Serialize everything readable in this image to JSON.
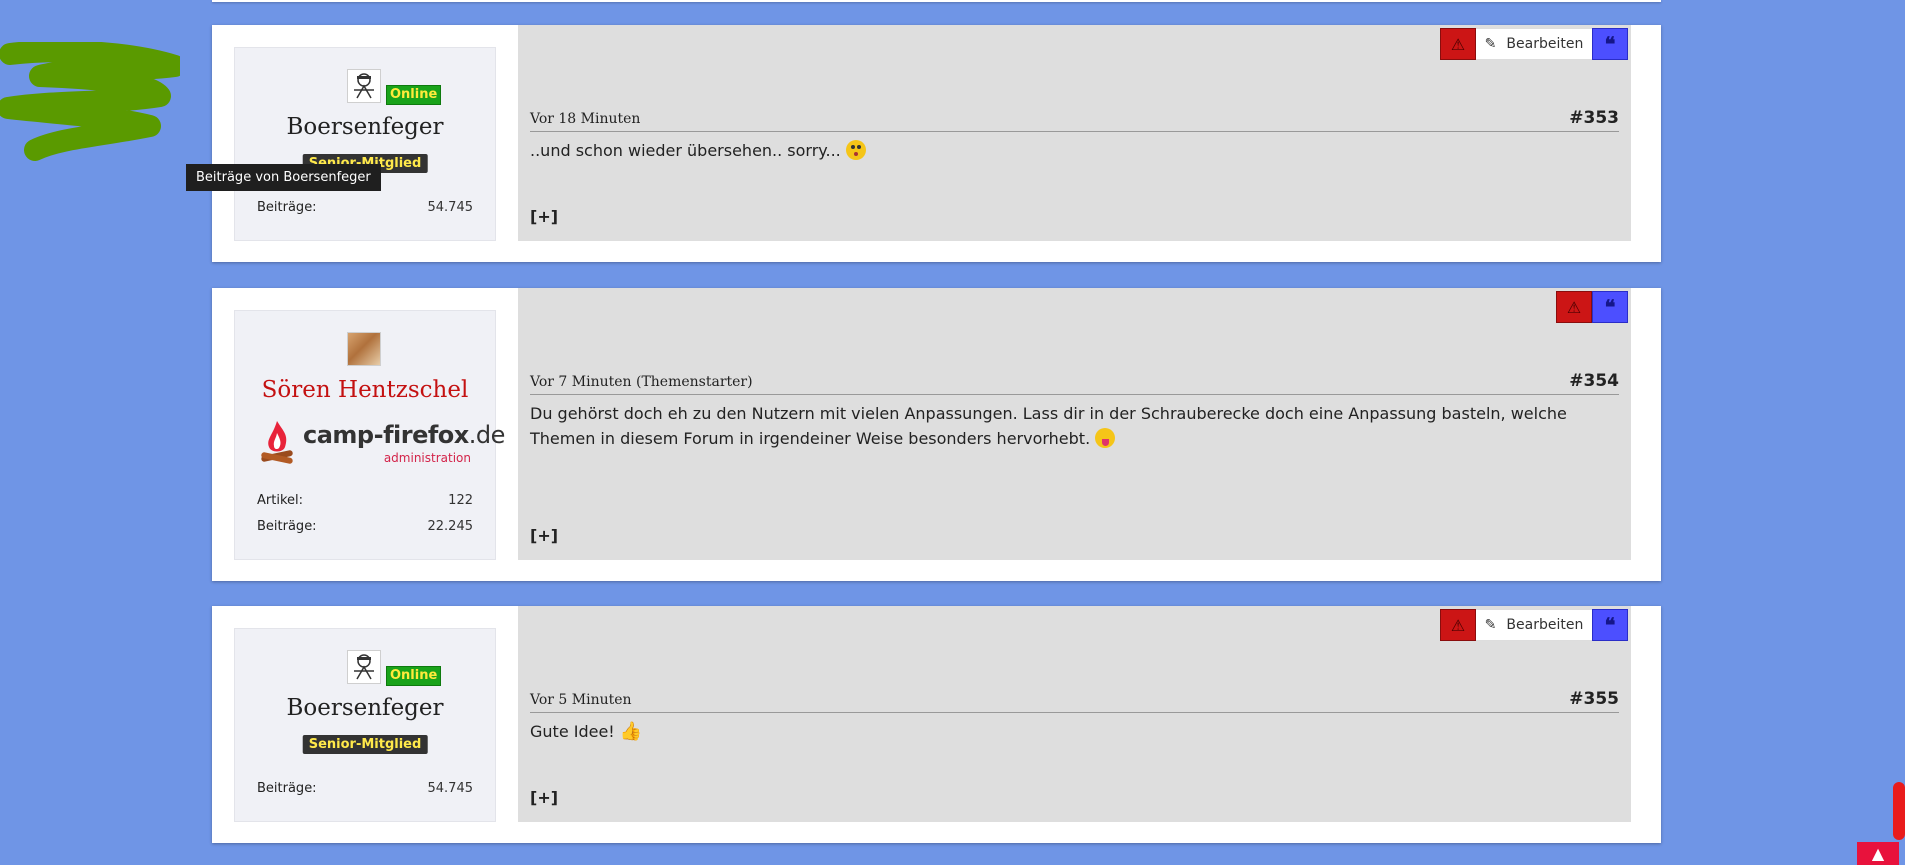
{
  "tooltip": "Beiträge von Boersenfeger",
  "buttons": {
    "edit_label": "Bearbeiten",
    "quote_glyph": "❝",
    "report_glyph": "⚠",
    "edit_glyph": "✎",
    "to_top_glyph": "▲"
  },
  "colors": {
    "background": "#6f95e6",
    "report": "#cc1515",
    "quote": "#4c4fff",
    "online": "#1aa31a",
    "rank": "#333333"
  },
  "posts": [
    {
      "user": {
        "name": "Boersenfeger",
        "online_label": "Online",
        "rank": "Senior-Mitglied",
        "posts_label": "Beiträge:",
        "posts_value": "54.745"
      },
      "time": "Vor 18 Minuten",
      "number": "#353",
      "text": "..und schon wieder übersehen.. sorry...",
      "emoji": "flushed-face",
      "expand": "[+]"
    },
    {
      "user": {
        "name": "Sören Hentzschel",
        "logo_text": "camp-firefox",
        "logo_tld": ".de",
        "logo_sub": "administration",
        "articles_label": "Artikel:",
        "articles_value": "122",
        "posts_label": "Beiträge:",
        "posts_value": "22.245"
      },
      "time": "Vor 7 Minuten (Themenstarter)",
      "number": "#354",
      "text": "Du gehörst doch eh zu den Nutzern mit vielen Anpassungen. Lass dir in der Schrauberecke doch eine Anpassung basteln, welche Themen in diesem Forum in irgendeiner Weise besonders hervorhebt.",
      "emoji": "tongue-face",
      "expand": "[+]"
    },
    {
      "user": {
        "name": "Boersenfeger",
        "online_label": "Online",
        "rank": "Senior-Mitglied",
        "posts_label": "Beiträge:",
        "posts_value": "54.745"
      },
      "time": "Vor 5 Minuten",
      "number": "#355",
      "text": "Gute Idee!",
      "emoji": "thumbs-up",
      "expand": "[+]"
    }
  ]
}
